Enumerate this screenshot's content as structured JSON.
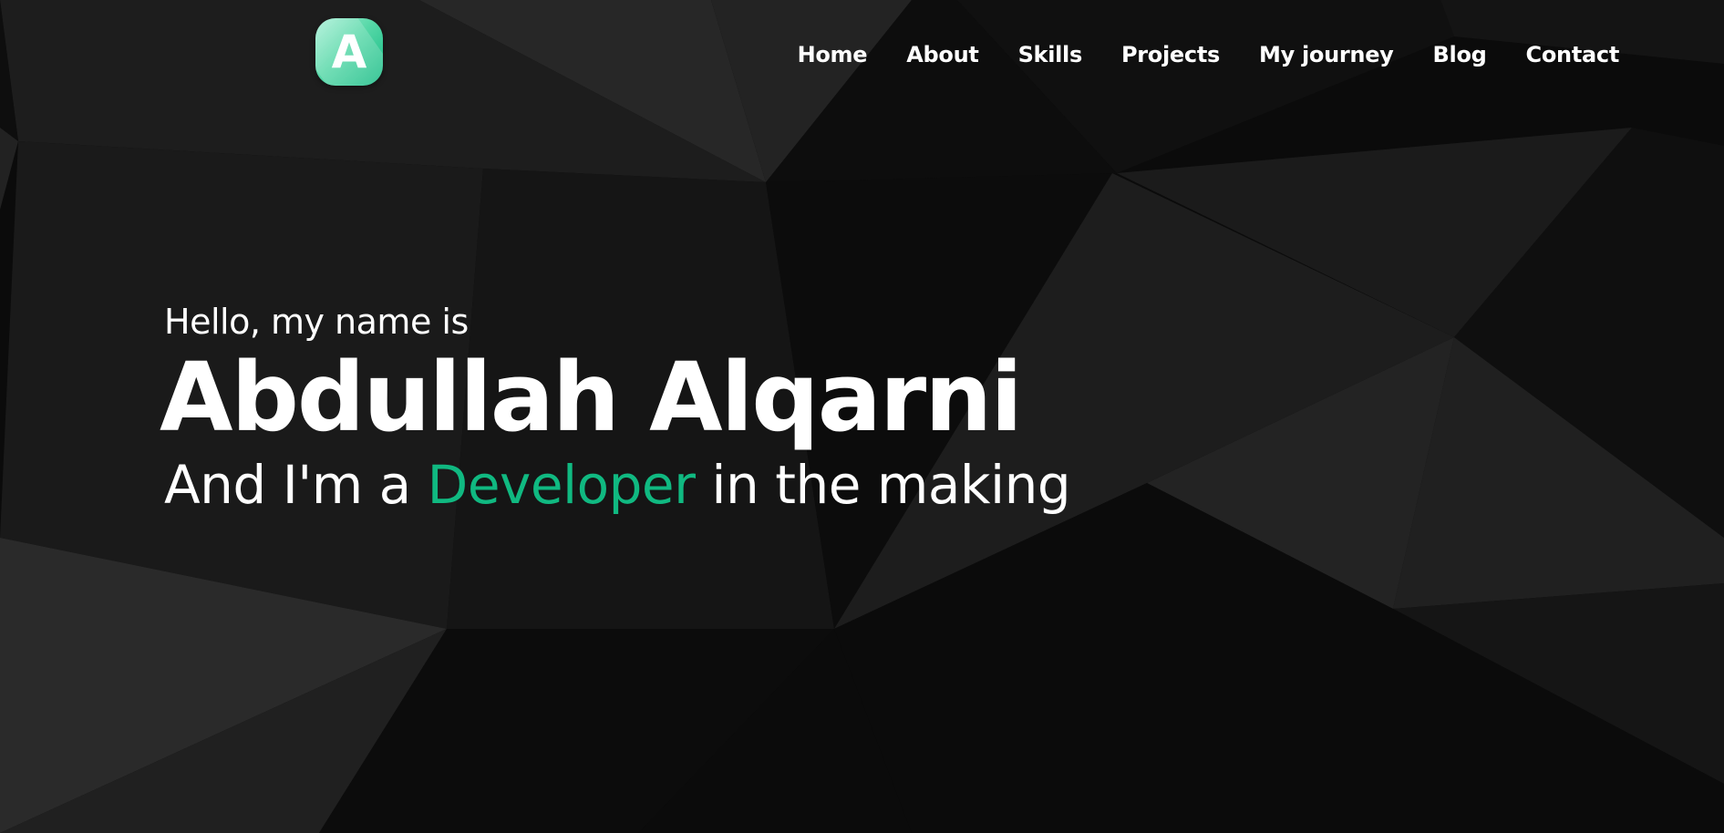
{
  "logo": {
    "letter": "A",
    "colors": [
      "#a8f0d6",
      "#57d8a8",
      "#10b981"
    ]
  },
  "nav": {
    "items": [
      {
        "label": "Home"
      },
      {
        "label": "About"
      },
      {
        "label": "Skills"
      },
      {
        "label": "Projects"
      },
      {
        "label": "My journey"
      },
      {
        "label": "Blog"
      },
      {
        "label": "Contact"
      }
    ]
  },
  "hero": {
    "greeting": "Hello, my name is",
    "name": "Abdullah Alqarni",
    "tagline_prefix": "And I'm a",
    "tagline_highlight": "Developer",
    "tagline_suffix": "in the making"
  },
  "colors": {
    "accent": "#10b981",
    "background": "#0b0b0b",
    "text": "#ffffff"
  }
}
